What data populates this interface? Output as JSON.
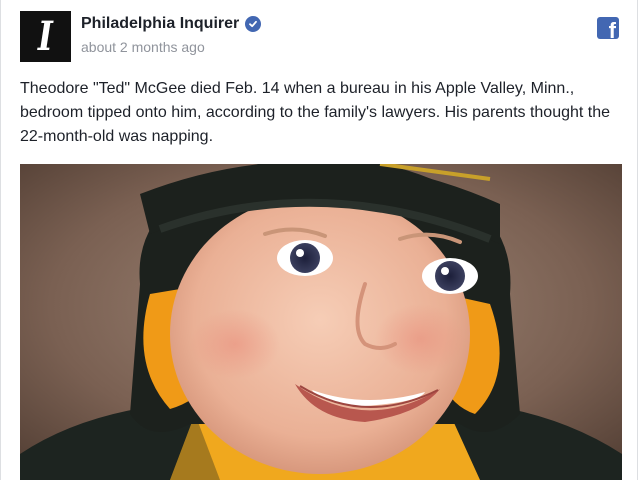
{
  "post": {
    "page_name": "Philadelphia Inquirer",
    "avatar_letter": "I",
    "timestamp": "about 2 months ago",
    "text": "Theodore \"Ted\" McGee died Feb. 14 when a bureau in his Apple Valley, Minn., bedroom tipped onto him, according to the family's lawyers. His parents thought the 22-month-old was napping.",
    "verified_icon": "verified-badge-icon",
    "platform_icon": "facebook-icon"
  },
  "colors": {
    "facebook_blue": "#4267b2",
    "text_primary": "#1d2129",
    "text_secondary": "#90949c"
  }
}
